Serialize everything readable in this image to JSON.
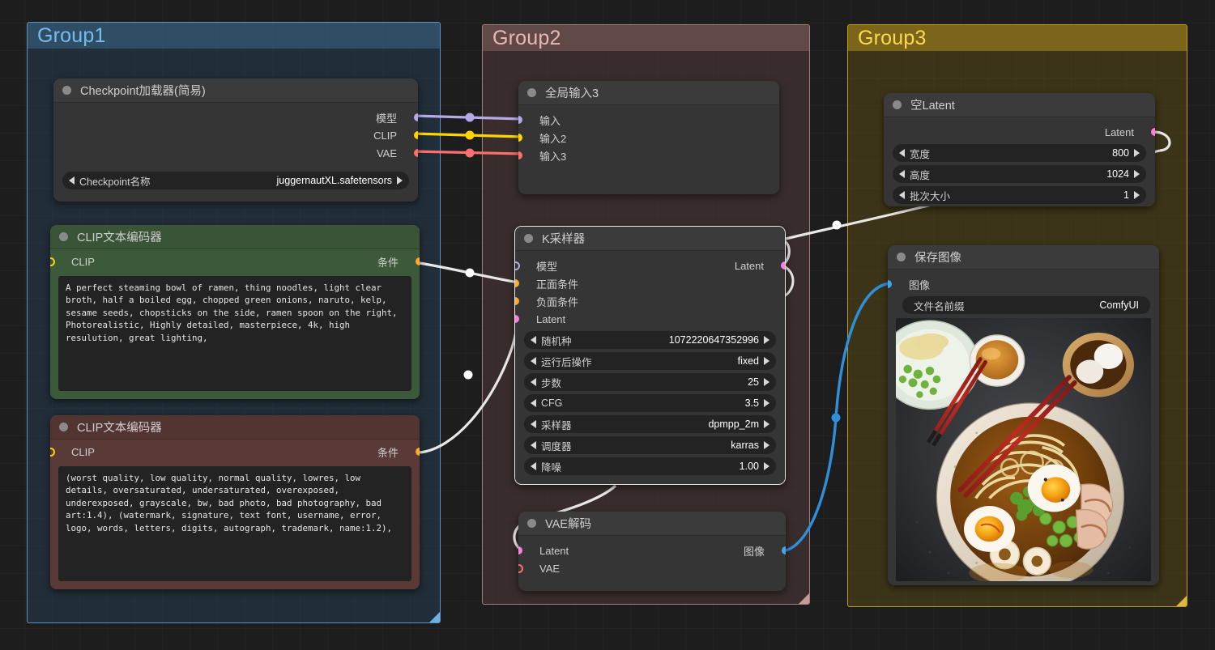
{
  "groups": [
    {
      "title": "Group1",
      "color": "#5792c4"
    },
    {
      "title": "Group2",
      "color": "#a07f7b"
    },
    {
      "title": "Group3",
      "color": "#c09b26"
    }
  ],
  "nodes": {
    "checkpoint_loader": {
      "title": "Checkpoint加载器(简易)",
      "outputs": [
        {
          "label": "模型",
          "color": "#b6a9e8"
        },
        {
          "label": "CLIP",
          "color": "#ffd500"
        },
        {
          "label": "VAE",
          "color": "#ff6e6e"
        }
      ],
      "widgets": [
        {
          "name": "Checkpoint名称",
          "value": "juggernautXL.safetensors"
        }
      ]
    },
    "clip_positive": {
      "title": "CLIP文本编码器",
      "input": {
        "label": "CLIP",
        "color": "#ffd500"
      },
      "output": {
        "label": "条件",
        "color": "#ffa931"
      },
      "text": "A perfect steaming bowl of ramen, thing noodles, light clear broth, half a boiled egg, chopped green onions, naruto, kelp, sesame seeds, chopsticks on the side, ramen spoon on the right, Photorealistic, Highly detailed, masterpiece, 4k, high resulution, great lighting,"
    },
    "clip_negative": {
      "title": "CLIP文本编码器",
      "input": {
        "label": "CLIP",
        "color": "#ffd500"
      },
      "output": {
        "label": "条件",
        "color": "#ffa931"
      },
      "text": "(worst quality, low quality, normal quality, lowres, low details, oversaturated, undersaturated, overexposed, underexposed, grayscale, bw, bad photo, bad photography, bad art:1.4), (watermark, signature, text font, username, error, logo, words, letters, digits, autograph, trademark, name:1.2),"
    },
    "global_input": {
      "title": "全局输入3",
      "inputs": [
        {
          "label": "输入",
          "color": "#b6a9e8"
        },
        {
          "label": "输入2",
          "color": "#ffd500"
        },
        {
          "label": "输入3",
          "color": "#ff6e6e"
        }
      ]
    },
    "ksampler": {
      "title": "K采样器",
      "inputs": [
        {
          "label": "模型",
          "color": "#b6a9e8"
        },
        {
          "label": "正面条件",
          "color": "#ffa931"
        },
        {
          "label": "负面条件",
          "color": "#ffa931"
        },
        {
          "label": "Latent",
          "color": "#ff7fe0"
        }
      ],
      "outputs": [
        {
          "label": "Latent",
          "color": "#ff7fe0"
        }
      ],
      "widgets": [
        {
          "name": "随机种",
          "value": "1072220647352996"
        },
        {
          "name": "运行后操作",
          "value": "fixed"
        },
        {
          "name": "步数",
          "value": "25"
        },
        {
          "name": "CFG",
          "value": "3.5"
        },
        {
          "name": "采样器",
          "value": "dpmpp_2m"
        },
        {
          "name": "调度器",
          "value": "karras"
        },
        {
          "name": "降噪",
          "value": "1.00"
        }
      ]
    },
    "vae_decode": {
      "title": "VAE解码",
      "inputs": [
        {
          "label": "Latent",
          "color": "#ff7fe0"
        },
        {
          "label": "VAE",
          "color": "#ff6e6e"
        }
      ],
      "outputs": [
        {
          "label": "图像",
          "color": "#4aa3e8"
        }
      ]
    },
    "empty_latent": {
      "title": "空Latent",
      "outputs": [
        {
          "label": "Latent",
          "color": "#ff7fe0"
        }
      ],
      "widgets": [
        {
          "name": "宽度",
          "value": "800"
        },
        {
          "name": "高度",
          "value": "1024"
        },
        {
          "name": "批次大小",
          "value": "1"
        }
      ]
    },
    "save_image": {
      "title": "保存图像",
      "inputs": [
        {
          "label": "图像",
          "color": "#4aa3e8"
        }
      ],
      "widgets": [
        {
          "name": "文件名前缀",
          "value": "ComfyUI"
        }
      ],
      "preview_alt": "ramen-bowl-preview"
    }
  },
  "link_colors": {
    "model": "#b6a9e8",
    "clip": "#ffd500",
    "vae": "#ff6e6e",
    "conditioning": "#e8e8e8",
    "latent": "#e8e8e8",
    "image": "#2f8fd8"
  }
}
